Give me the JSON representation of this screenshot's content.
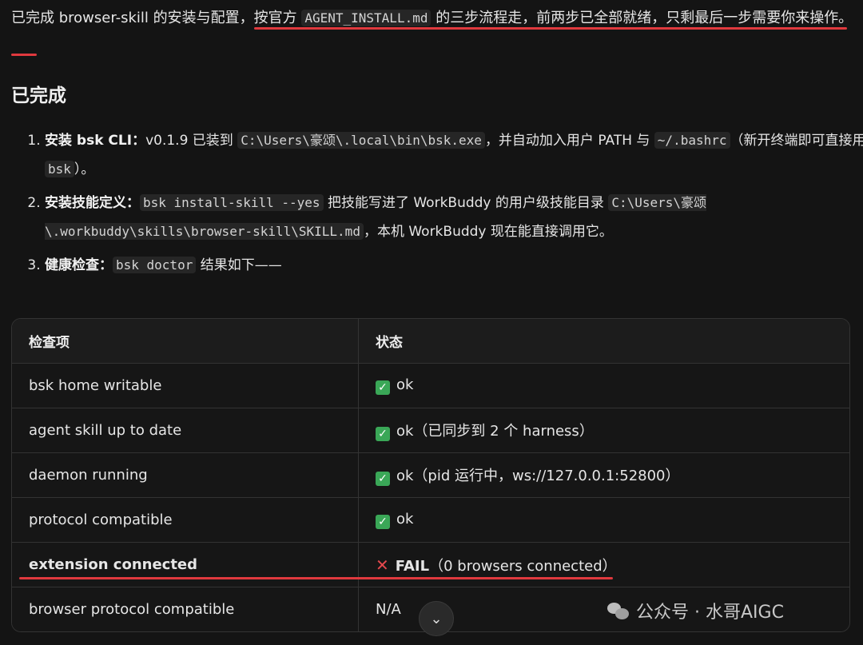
{
  "intro": {
    "text_before": "已完成 browser-skill 的安装与配置，",
    "highlight_prefix": "按官方 ",
    "code": "AGENT_INSTALL.md",
    "highlight_suffix": " 的三步流程走，前两步已全部就绪，只剩最后一步需要你来操作。"
  },
  "section_title": "已完成",
  "steps": [
    {
      "title": "安装 bsk CLI：",
      "t1": "v0.1.9 已装到 ",
      "c1": "C:\\Users\\豪颂\\.local\\bin\\bsk.exe",
      "t2": "，并自动加入用户 PATH 与 ",
      "c2": "~/.bashrc",
      "t3": "（新开终端即可直接用 ",
      "c3": "bsk",
      "t4": "）。"
    },
    {
      "title": "安装技能定义：",
      "c1": "bsk install-skill --yes",
      "t1": " 把技能写进了 WorkBuddy 的用户级技能目录 ",
      "c2": "C:\\Users\\豪颂\\.workbuddy\\skills\\browser-skill\\SKILL.md",
      "t2": "，本机 WorkBuddy 现在能直接调用它。"
    },
    {
      "title": "健康检查：",
      "c1": "bsk doctor",
      "t1": " 结果如下——"
    }
  ],
  "table": {
    "headers": [
      "检查项",
      "状态"
    ],
    "rows": [
      {
        "item": "bsk home writable",
        "status": "ok"
      },
      {
        "item": "agent skill up to date",
        "status": "ok（已同步到 2 个 harness）"
      },
      {
        "item": "daemon running",
        "status": "ok（pid 运行中，ws://127.0.0.1:52800）"
      },
      {
        "item": "protocol compatible",
        "status": "ok"
      },
      {
        "item": "extension connected",
        "status_bold": "FAIL",
        "status": "（0 browsers connected）"
      },
      {
        "item": "browser protocol compatible",
        "status": "N/A"
      }
    ]
  },
  "watermark": "公众号 · 水哥AIGC",
  "colors": {
    "accent_red": "#e0393e",
    "check_green": "#3aa757",
    "background": "#141414"
  }
}
